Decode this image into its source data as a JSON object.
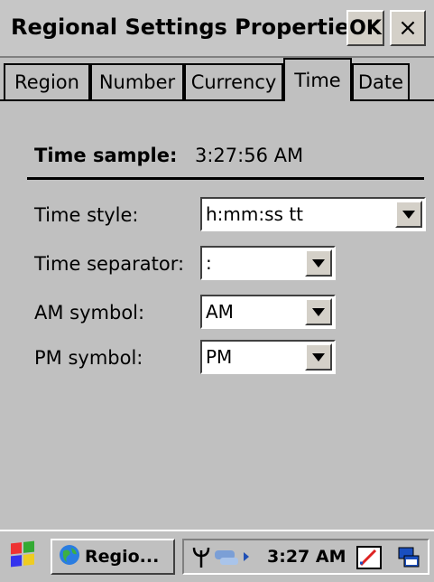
{
  "window": {
    "title": "Regional Settings Properties",
    "ok_label": "OK",
    "close_label": "×"
  },
  "tabs": [
    {
      "label": "Region"
    },
    {
      "label": "Number"
    },
    {
      "label": "Currency"
    },
    {
      "label": "Time",
      "active": true
    },
    {
      "label": "Date"
    }
  ],
  "time_tab": {
    "sample_label": "Time sample:",
    "sample_value": "3:27:56 AM",
    "time_style": {
      "label": "Time style:",
      "value": "h:mm:ss tt"
    },
    "time_separator": {
      "label": "Time separator:",
      "value": ":"
    },
    "am_symbol": {
      "label": "AM symbol:",
      "value": "AM"
    },
    "pm_symbol": {
      "label": "PM symbol:",
      "value": "PM"
    }
  },
  "taskbar": {
    "task_label": "Regio...",
    "clock": "3:27 AM",
    "icons": [
      "start-icon",
      "regional-settings-icon",
      "antenna-icon",
      "network-icon",
      "keyboard-icon",
      "desktop-icon"
    ]
  },
  "colors": {
    "background": "#c0c0c0",
    "field": "#ffffff",
    "text": "#000000"
  }
}
